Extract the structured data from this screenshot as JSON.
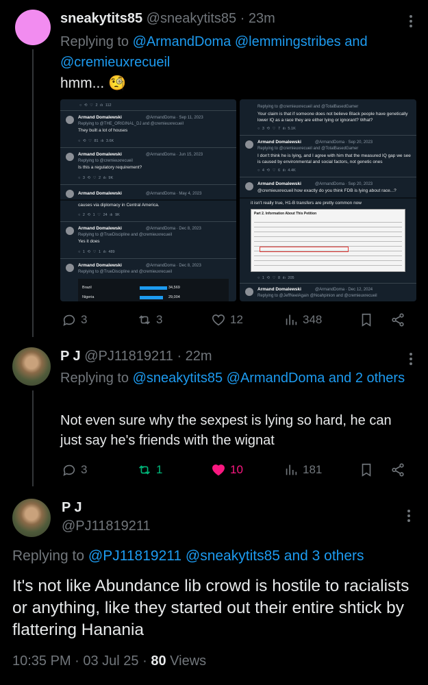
{
  "tweet1": {
    "display_name": "sneakytits85",
    "handle": "@sneakytits85",
    "time": "· 23m",
    "replying_prefix": "Replying to",
    "replying_to": "@ArmandDoma @lemmingstribes and @cremieuxrecueil",
    "text": "hmm... 🧐",
    "avatar_color": "#f28cf0",
    "stats": {
      "replies": "3",
      "reposts": "3",
      "likes": "12",
      "views": "348"
    },
    "embedded_images": {
      "left_posts": [
        {
          "name": "Armand Domalewski",
          "meta": "@ArmandDoma · Sep 11, 2023",
          "replying": "Replying to @THE_ORIGINAL_DJ and @cremieuxrecueil",
          "text": "They built a lot of houses",
          "acts": "○    ⟲    ♡ 81    ılı 3.6K"
        },
        {
          "name": "Armand Domalewski",
          "meta": "@ArmandDoma · Jun 15, 2023",
          "replying": "Replying to @cremieuxrecueil",
          "text": "Is this a regulatory requirement?",
          "acts": "○ 3    ⟲    ♡ 2    ılı 9K"
        },
        {
          "name": "Armand Domalewski",
          "meta": "@ArmandDoma · May 4, 2023",
          "replying": "",
          "text": "causes via diplomacy in Central America.",
          "acts": "○ 2    ⟲ 1    ♡ 24    ılı 9K"
        },
        {
          "name": "Armand Domalewski",
          "meta": "@ArmandDoma · Dec 8, 2023",
          "replying": "Replying to @TrueDiscipline and @cremieuxrecueil",
          "text": "Yes it does",
          "acts": "○ 1    ⟲    ♡ 1    ılı 489"
        },
        {
          "name": "Armand Domalewski",
          "meta": "@ArmandDoma · Dec 8, 2023",
          "replying": "Replying to @TrueDiscipline and @cremieuxrecueil",
          "text": "",
          "acts": ""
        }
      ],
      "left_top_acts": "○    ⟲    ♡ 2    ılı 112",
      "left_table": [
        {
          "country": "Brazil",
          "value": "34,569"
        },
        {
          "country": "Nigeria",
          "value": "29,004"
        }
      ],
      "right_posts": [
        {
          "name": "",
          "meta": "",
          "replying": "Replying to @cremieuxrecueil and @TotalBasedGamer",
          "text": "Your claim is that if someone does not believe Black people have genetically lower IQ as a race they are either lying or ignorant? What?",
          "acts": "○ 3    ⟲    ♡ 7    ılı 5.1K"
        },
        {
          "name": "Armand Domalewski",
          "meta": "@ArmandDoma · Sep 20, 2023",
          "replying": "Replying to @cremieuxrecueil and @TotalBasedGamer",
          "text": "I don't think he is lying, and I agree with him that the measured IQ gap we see is caused by environmental and social factors, not genetic ones",
          "acts": "○ 4    ⟲    ♡ 6    ılı 4.4K"
        },
        {
          "name": "Armand Domalewski",
          "meta": "@ArmandDoma · Sep 20, 2023",
          "replying": "",
          "text": "@cremieuxrecueil how exactly do you think FDB is lying about race...?",
          "acts": ""
        },
        {
          "name": "Armand Domalewski",
          "meta": "@ArmandDoma · Dec 12, 2024",
          "replying": "Replying to @JeffNeelAgain @Noahpinion and @cremieuxrecueil",
          "text": "",
          "acts": ""
        }
      ],
      "right_doc_caption": "it isn't really true, H1-B transfers are pretty common now",
      "right_doc_title": "Part 2. Information About This Petition",
      "right_doc_acts": "○ 1    ⟲    ♡ 8    ılı 205"
    }
  },
  "tweet2": {
    "display_name": "P J",
    "handle": "@PJ11819211",
    "time": "· 22m",
    "replying_prefix": "Replying to",
    "replying_to": "@sneakytits85 @ArmandDoma and 2 others",
    "text": "Not even sure why the sexpest is lying so hard, he can just say he's friends with the wignat",
    "stats": {
      "replies": "3",
      "reposts": "1",
      "likes": "10",
      "views": "181"
    }
  },
  "tweet3": {
    "display_name": "P J",
    "handle": "@PJ11819211",
    "replying_prefix": "Replying to",
    "replying_to": "@PJ11819211 @sneakytits85 and 3 others",
    "text": "It's not like Abundance lib crowd is hostile to racialists or anything, like they started out their entire shtick by flattering Hanania",
    "time": "10:35 PM · 03 Jul 25 ·",
    "views_count": "80",
    "views_label": "Views"
  },
  "colors": {
    "accent": "#1d9bf0",
    "repost_active": "#00ba7c",
    "like_active": "#f91880",
    "muted": "#71767b"
  }
}
